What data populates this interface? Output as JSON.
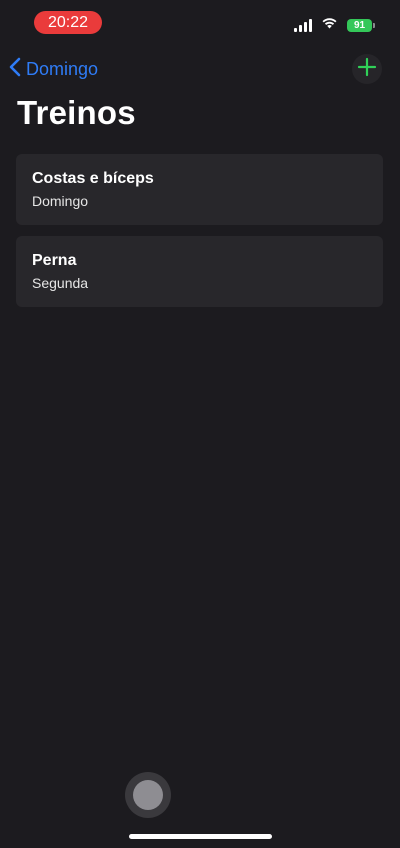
{
  "status_bar": {
    "time": "20:22",
    "battery_level": "91",
    "battery_color": "#34c759",
    "time_pill_color": "#ea3b3b"
  },
  "nav": {
    "back_label": "Domingo",
    "back_icon": "chevron-left-icon",
    "add_icon": "plus-icon",
    "accent_color": "#2f7cf6",
    "add_color": "#30d158"
  },
  "page": {
    "title": "Treinos"
  },
  "workouts": [
    {
      "name": "Costas e bíceps",
      "day": "Domingo"
    },
    {
      "name": "Perna",
      "day": "Segunda"
    }
  ]
}
